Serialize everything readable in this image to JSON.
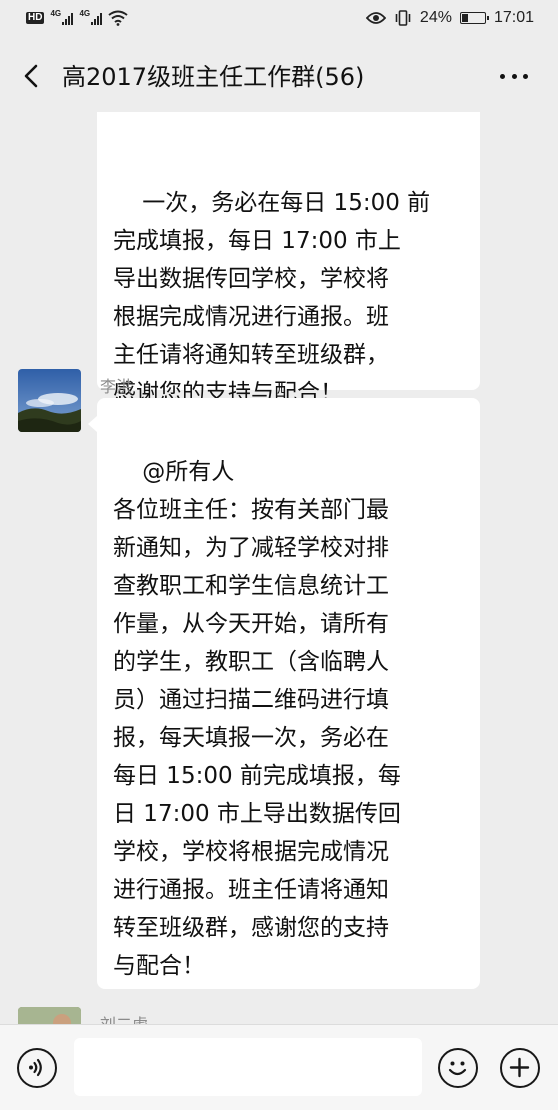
{
  "status_bar": {
    "hd_label": "HD",
    "network_1": "4G",
    "network_2": "4G",
    "battery_percent": "24%",
    "battery_level": 0.24,
    "time": "17:01"
  },
  "header": {
    "title": "高2017级班主任工作群(56)",
    "back_icon": "chevron-left-icon",
    "more_icon": "more-dots-icon"
  },
  "messages": [
    {
      "sender": "",
      "text": "一次，务必在每日 15:00 前\n完成填报，每日 17:00 市上\n导出数据传回学校，学校将\n根据完成情况进行通报。班\n主任请将通知转至班级群，\n感谢您的支持与配合！"
    },
    {
      "sender": "李洪",
      "text": "@所有人\n各位班主任：按有关部门最\n新通知，为了减轻学校对排\n查教职工和学生信息统计工\n作量，从今天开始，请所有\n的学生，教职工（含临聘人\n员）通过扫描二维码进行填\n报，每天填报一次，务必在\n每日 15:00 前完成填报，每\n日 17:00 市上导出数据传回\n学校，学校将根据完成情况\n进行通报。班主任请将通知\n转至班级群，感谢您的支持\n与配合！"
    },
    {
      "sender": "刘二虎",
      "text": ""
    }
  ],
  "input_bar": {
    "voice_icon": "voice-icon",
    "emoji_icon": "emoji-icon",
    "plus_icon": "plus-icon",
    "text_value": ""
  },
  "colors": {
    "background": "#ededed",
    "bubble": "#ffffff",
    "sender_name": "#8a8a8a"
  }
}
